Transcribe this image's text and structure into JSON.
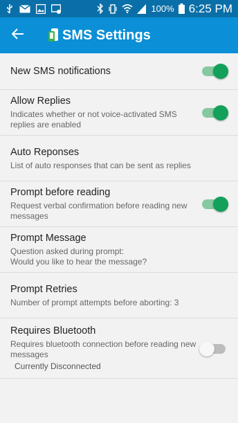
{
  "status_bar": {
    "battery_percent": "100%",
    "time": "6:25 PM",
    "icons": [
      "usb-icon",
      "mail-icon",
      "image-icon",
      "screen-icon",
      "bluetooth-icon",
      "vibrate-icon",
      "wifi-icon",
      "signal-icon",
      "battery-icon"
    ]
  },
  "app_bar": {
    "title": "SMS Settings",
    "back_icon": "arrow-back-icon",
    "logo_icon": "phone-app-icon"
  },
  "colors": {
    "status_bar": "#0a6fa8",
    "app_bar": "#0b8fd6",
    "toggle_on": "#13a05a",
    "toggle_on_track": "#86c8a0",
    "toggle_off_track": "#bdbdbd"
  },
  "settings": {
    "new_sms": {
      "title": "New SMS notifications",
      "enabled": true
    },
    "allow_replies": {
      "title": "Allow Replies",
      "summary": "Indicates whether or not voice-activated SMS replies are enabled",
      "enabled": true
    },
    "auto_responses": {
      "title": "Auto Reponses",
      "summary": "List of auto responses that can be sent as replies"
    },
    "prompt_before_reading": {
      "title": "Prompt before reading",
      "summary": "Request verbal confirmation before reading new messages",
      "enabled": true
    },
    "prompt_message": {
      "title": "Prompt Message",
      "summary_line1": "Question asked during prompt:",
      "summary_line2": "Would you like to hear the message?"
    },
    "prompt_retries": {
      "title": "Prompt Retries",
      "summary": "Number of prompt attempts before aborting: 3"
    },
    "requires_bluetooth": {
      "title": "Requires Bluetooth",
      "summary": "Requires bluetooth connection before reading new messages",
      "status": "Currently Disconnected",
      "enabled": false
    }
  }
}
